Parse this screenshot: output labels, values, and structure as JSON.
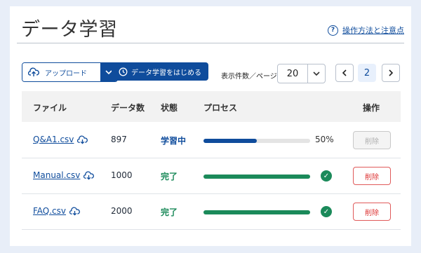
{
  "page": {
    "title": "データ学習",
    "help_link": "操作方法と注意点"
  },
  "toolbar": {
    "upload_label": "アップロード",
    "start_label": "データ学習をはじめる",
    "per_page_label": "表示件数／ページ",
    "per_page_value": "20",
    "current_page": "2"
  },
  "table": {
    "headers": {
      "file": "ファイル",
      "count": "データ数",
      "status": "状態",
      "process": "プロセス",
      "action": "操作"
    },
    "rows": [
      {
        "file": "Q&A1.csv",
        "count": "897",
        "status": "学習中",
        "progress": 0.5,
        "progress_label": "50%",
        "action": "削除",
        "action_enabled": false
      },
      {
        "file": "Manual.csv",
        "count": "1000",
        "status": "完了",
        "progress": 1.0,
        "action": "削除",
        "action_enabled": true
      },
      {
        "file": "FAQ.csv",
        "count": "2000",
        "status": "完了",
        "progress": 1.0,
        "action": "削除",
        "action_enabled": true
      }
    ]
  },
  "colors": {
    "primary": "#0f4c9c",
    "success": "#1b8a5a",
    "danger": "#d33333"
  }
}
